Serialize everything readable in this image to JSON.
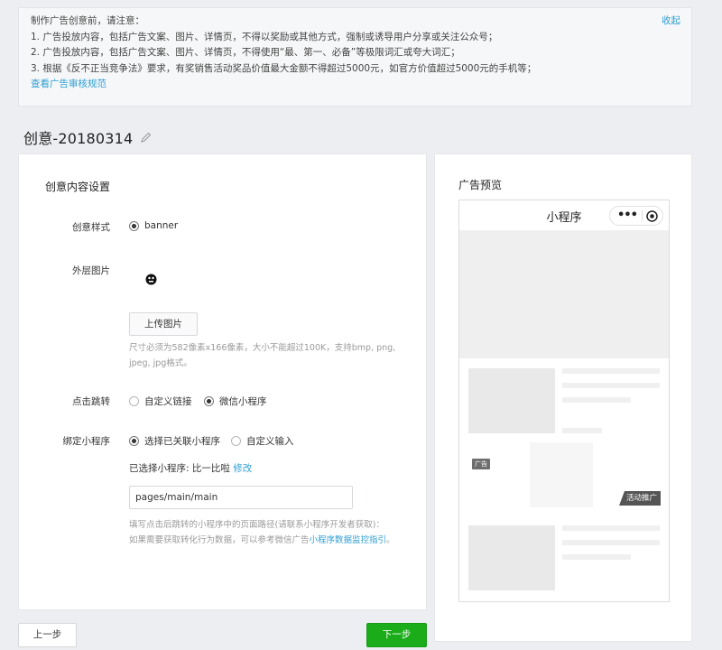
{
  "notice": {
    "heading": "制作广告创意前，请注意：",
    "collapse": "收起",
    "items": [
      "1. 广告投放内容，包括广告文案、图片、详情页，不得以奖励或其他方式，强制或诱导用户分享或关注公众号；",
      "2. 广告投放内容，包括广告文案、图片、详情页，不得使用“最、第一、必备”等极限词汇或夸大词汇；",
      "3. 根据《反不正当竞争法》要求，有奖销售活动奖品价值最大金额不得超过5000元，如官方价值超过5000元的手机等；"
    ],
    "link": "查看广告审核规范"
  },
  "page_title": "创意-20180314",
  "form": {
    "section_title": "创意内容设置",
    "style_label": "创意样式",
    "style_option": "banner",
    "image_label": "外层图片",
    "upload_button": "上传图片",
    "upload_hint_1": "尺寸必须为582像素x166像素，大小不能超过100K，支持bmp, png,",
    "upload_hint_2": "jpeg, jpg格式。",
    "jump_label": "点击跳转",
    "jump_options": [
      "自定义链接",
      "微信小程序"
    ],
    "jump_selected": "微信小程序",
    "bind_label": "绑定小程序",
    "bind_options": [
      "选择已关联小程序",
      "自定义输入"
    ],
    "bind_selected": "选择已关联小程序",
    "selected_prefix": "已选择小程序: 比一比啦",
    "selected_edit": "修改",
    "path_value": "pages/main/main",
    "path_hint_1": "填写点击后跳转的小程序中的页面路径(请联系小程序开发者获取)：",
    "path_hint_2_prefix": "如果需要获取转化行为数据，可以参考微信广告",
    "path_hint_2_link": "小程序数据监控指引",
    "path_hint_2_suffix": "。"
  },
  "preview": {
    "title": "广告预览",
    "phone_title": "小程序",
    "ad_tag": "广告",
    "promo_label": "活动推广"
  },
  "footer": {
    "prev": "上一步",
    "next": "下一步"
  },
  "colors": {
    "accent_link": "#2f9fd3",
    "primary_button": "#1aad19"
  }
}
